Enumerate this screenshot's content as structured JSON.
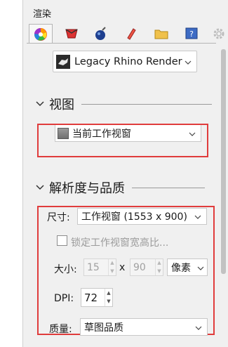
{
  "panel": {
    "title": "渲染"
  },
  "tabs": [
    {
      "icon": "color-wheel-icon"
    },
    {
      "icon": "material-icon"
    },
    {
      "icon": "environment-icon"
    },
    {
      "icon": "texture-icon"
    },
    {
      "icon": "folder-icon"
    },
    {
      "icon": "help-icon"
    },
    {
      "icon": "settings-gear-icon"
    }
  ],
  "renderer": {
    "selected": "Legacy Rhino Render",
    "icon": "rhino-render-icon"
  },
  "view_section": {
    "title": "视图",
    "viewport_selected": "当前工作视窗"
  },
  "resolution_section": {
    "title": "解析度与品质",
    "size_label": "尺寸:",
    "size_value": "工作视窗 (1553 x 900)",
    "lock_ratio_label": "锁定工作视窗宽高比...",
    "dimensions_label": "大小:",
    "width_value": "15",
    "times_symbol": "x",
    "height_value": "90",
    "unit_value": "像素",
    "dpi_label": "DPI:",
    "dpi_value": "72",
    "quality_label": "质量:",
    "quality_value": "草图品质"
  },
  "colors": {
    "highlight_box": "#e03c3c",
    "accent": "#1a1a1a"
  }
}
